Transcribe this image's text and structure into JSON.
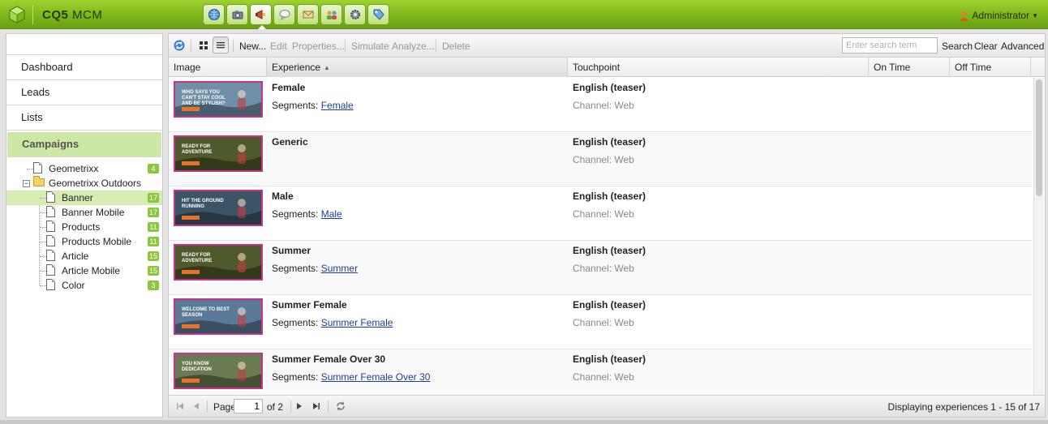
{
  "app": {
    "logo_bold": "CQ5",
    "logo_rest": "MCM",
    "user": "Administrator"
  },
  "nav_icons": [
    "globe-icon",
    "camera-icon",
    "megaphone-icon",
    "speech-bubble-icon",
    "envelope-icon",
    "people-icon",
    "gear-icon",
    "tag-icon"
  ],
  "sidebar": {
    "items": [
      {
        "label": "Dashboard"
      },
      {
        "label": "Leads"
      },
      {
        "label": "Lists"
      },
      {
        "label": "Campaigns"
      }
    ],
    "tree": [
      {
        "label": "Geometrixx",
        "count": "4"
      },
      {
        "label": "Geometrixx Outdoors"
      },
      {
        "label": "Banner",
        "count": "17"
      },
      {
        "label": "Banner Mobile",
        "count": "17"
      },
      {
        "label": "Products",
        "count": "11"
      },
      {
        "label": "Products Mobile",
        "count": "11"
      },
      {
        "label": "Article",
        "count": "15"
      },
      {
        "label": "Article Mobile",
        "count": "15"
      },
      {
        "label": "Color",
        "count": "3"
      }
    ]
  },
  "toolbar": {
    "new": "New...",
    "edit": "Edit",
    "properties": "Properties...",
    "simulate": "Simulate",
    "analyze": "Analyze...",
    "delete": "Delete",
    "search_placeholder": "Enter search term",
    "search": "Search",
    "clear": "Clear",
    "advanced": "Advanced"
  },
  "columns": {
    "image": "Image",
    "experience": "Experience",
    "touchpoint": "Touchpoint",
    "on_time": "On Time",
    "off_time": "Off Time"
  },
  "rows": [
    {
      "name": "Female",
      "segments_label": "Segments:",
      "segment": "Female",
      "touchpoint": "English (teaser)",
      "channel": "Channel: Web",
      "thumb_text": "Who says you can't stay cool and be stylish?"
    },
    {
      "name": "Generic",
      "segments_label": "",
      "segment": "",
      "touchpoint": "English (teaser)",
      "channel": "Channel: Web",
      "thumb_text": "Ready for adventure"
    },
    {
      "name": "Male",
      "segments_label": "Segments:",
      "segment": "Male",
      "touchpoint": "English (teaser)",
      "channel": "Channel: Web",
      "thumb_text": "Hit the ground running"
    },
    {
      "name": "Summer",
      "segments_label": "Segments:",
      "segment": "Summer",
      "touchpoint": "English (teaser)",
      "channel": "Channel: Web",
      "thumb_text": "Ready for adventure"
    },
    {
      "name": "Summer Female",
      "segments_label": "Segments:",
      "segment": "Summer Female",
      "touchpoint": "English (teaser)",
      "channel": "Channel: Web",
      "thumb_text": "Welcome to best season"
    },
    {
      "name": "Summer Female Over 30",
      "segments_label": "Segments:",
      "segment": "Summer Female Over 30",
      "touchpoint": "English (teaser)",
      "channel": "Channel: Web",
      "thumb_text": "You know dedication"
    }
  ],
  "thumb_colors": [
    "#6f8fa8",
    "#4f5a2c",
    "#3c5566",
    "#4f5a2c",
    "#5b7a98",
    "#6a7a52"
  ],
  "pager": {
    "page_label": "Page",
    "page_value": "1",
    "of_label": "of 2",
    "status": "Displaying experiences 1 - 15 of 17"
  },
  "colors": {
    "accent_green": "#8cc63f",
    "link_blue": "#1c3f94"
  }
}
